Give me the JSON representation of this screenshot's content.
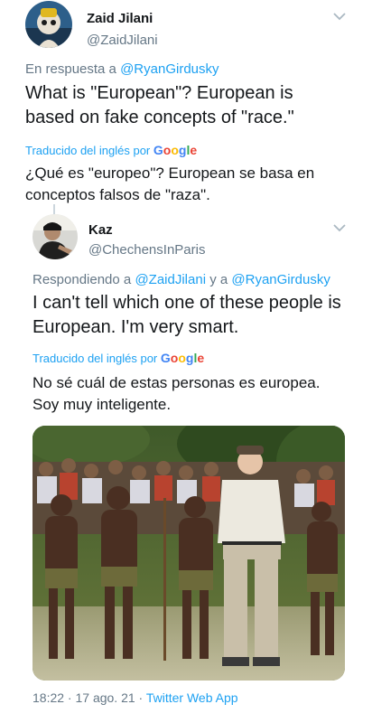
{
  "tweet1": {
    "name": "Zaid Jilani",
    "handle": "@ZaidJilani",
    "reply_prefix": "En respuesta a",
    "reply_mention": "@RyanGirdusky",
    "text": "What is \"European\"? European is based on fake concepts of \"race.\"",
    "translated_label": "Traducido del inglés por",
    "translation": "¿Qué es \"europeo\"? European se basa en conceptos falsos de \"raza\"."
  },
  "tweet2": {
    "name": "Kaz",
    "handle": "@ChechensInParis",
    "reply_prefix": "Respondiendo a",
    "reply_mention_1": "@ZaidJilani",
    "reply_joiner": "y a",
    "reply_mention_2": "@RyanGirdusky",
    "text": "I can't tell which one of these people is European. I'm very smart.",
    "translated_label": "Traducido del inglés por",
    "translation": "No sé cuál de estas personas es europea. Soy muy inteligente.",
    "timestamp": "18:22 · 17 ago. 21 ·",
    "source": "Twitter Web App"
  },
  "google_wordmark": [
    "G",
    "o",
    "o",
    "g",
    "l",
    "e"
  ],
  "colors": {
    "link": "#1da1f2",
    "secondary": "#657786",
    "text": "#14171a"
  },
  "icons": {
    "menu": "chevron-down-icon"
  }
}
